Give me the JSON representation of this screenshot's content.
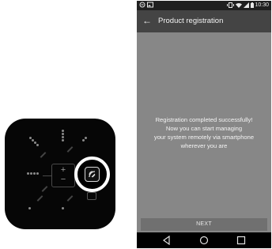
{
  "status_bar": {
    "left_icons": [
      "notification-icon",
      "image-icon"
    ],
    "right_icons": [
      "vibrate-icon",
      "wifi-icon",
      "signal-icon",
      "battery-icon"
    ],
    "time": "10:30"
  },
  "app_bar": {
    "back_icon": "back-arrow-icon",
    "title": "Product registration"
  },
  "message": {
    "line1": "Registration completed successfully!",
    "line2": "Now you can start managing",
    "line3": "your system remotely via smartphone",
    "line4": "wherever you are"
  },
  "next_button": {
    "label": "NEXT"
  },
  "nav_bar": {
    "icons": [
      "back-triangle-icon",
      "home-circle-icon",
      "recents-square-icon"
    ]
  },
  "device": {
    "dial_plus": "+",
    "dial_minus": "−",
    "highlight_icon": "remote-signal-icon"
  },
  "colors": {
    "phone_background": "#878787",
    "app_bar": "#444444",
    "status_bar": "#202020",
    "device_body": "#060606",
    "highlight_ring": "#ffffff"
  }
}
